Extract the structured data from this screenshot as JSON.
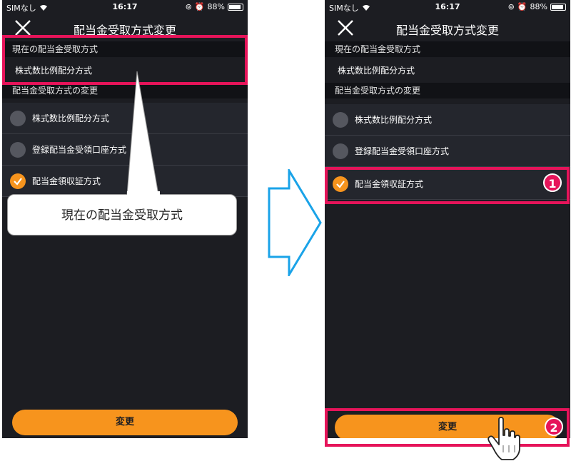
{
  "status": {
    "carrier": "SIMなし",
    "time": "16:17",
    "battery": "88%"
  },
  "nav": {
    "title": "配当金受取方式変更"
  },
  "current_section": {
    "header": "現在の配当金受取方式",
    "value": "株式数比例配分方式"
  },
  "change_section": {
    "header": "配当金受取方式の変更",
    "options": [
      {
        "label": "株式数比例配分方式"
      },
      {
        "label": "登録配当金受領口座方式"
      },
      {
        "label": "配当金領収証方式"
      }
    ]
  },
  "submit_label": "変更",
  "callout": {
    "text": "現在の配当金受取方式"
  },
  "badges": {
    "step1": "1",
    "step2": "2"
  },
  "colors": {
    "accent": "#f7941d",
    "highlight": "#e6145a",
    "arrow": "#1aa3e8",
    "background": "#1c1d22"
  }
}
